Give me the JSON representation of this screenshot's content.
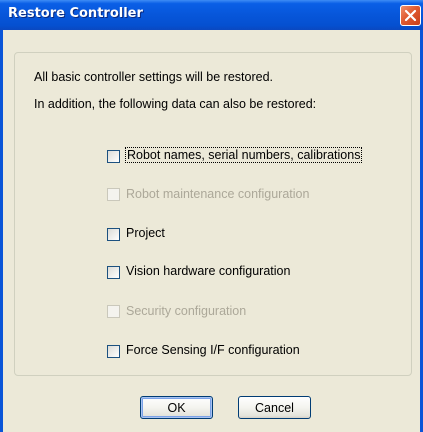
{
  "window": {
    "title": "Restore Controller",
    "close_icon": "close-icon"
  },
  "intro": {
    "line1": "All basic controller settings will be restored.",
    "line2": "In addition, the following data can also be restored:"
  },
  "options": [
    {
      "label": "Robot names, serial numbers, calibrations",
      "checked": false,
      "enabled": true
    },
    {
      "label": "Robot maintenance configuration",
      "checked": false,
      "enabled": false
    },
    {
      "label": "Project",
      "checked": false,
      "enabled": true
    },
    {
      "label": "Vision hardware configuration",
      "checked": false,
      "enabled": true
    },
    {
      "label": "Security configuration",
      "checked": false,
      "enabled": false
    },
    {
      "label": "Force Sensing I/F configuration",
      "checked": false,
      "enabled": true
    }
  ],
  "buttons": {
    "ok": "OK",
    "cancel": "Cancel"
  },
  "colors": {
    "titlebar": "#0756DA",
    "window_bg": "#ECE9D8",
    "disabled_text": "#ACA899",
    "close": "#E05A30"
  }
}
